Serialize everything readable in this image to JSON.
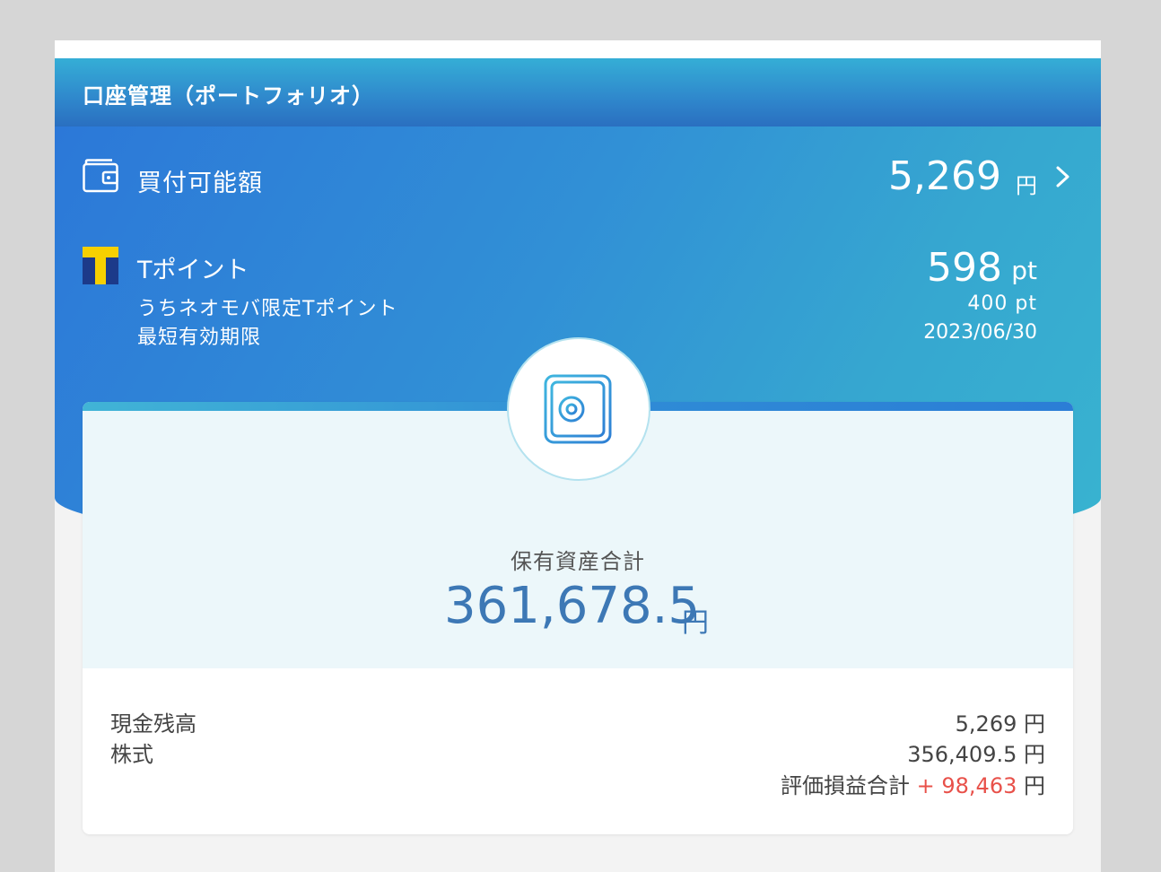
{
  "header": {
    "title": "口座管理（ポートフォリオ）"
  },
  "buying_power": {
    "label": "買付可能額",
    "value": "5,269",
    "unit": "円"
  },
  "tpoint": {
    "label": "Tポイント",
    "value": "598",
    "unit": "pt",
    "limited_label": "うちネオモバ限定Tポイント",
    "limited_value": "400 pt",
    "expiry_label": "最短有効期限",
    "expiry_date": "2023/06/30"
  },
  "assets": {
    "total_label": "保有資産合計",
    "total_value": "361,678.5",
    "total_unit": "円",
    "cash_label": "現金残高",
    "cash_value": "5,269 円",
    "stock_label": "株式",
    "stock_value": "356,409.5 円",
    "pl_label": "評価損益合計",
    "pl_sign": "+",
    "pl_value": "98,463",
    "pl_unit": "円"
  },
  "icons": {
    "wallet": "wallet-icon",
    "tpoint": "tpoint-logo-icon",
    "safe": "safe-icon",
    "chevron": "chevron-right-icon"
  },
  "colors": {
    "header_start": "#35aed6",
    "header_end": "#2a6fc0",
    "total_value": "#3d78b5",
    "profit": "#e8514a",
    "tpoint_yellow": "#f7d000",
    "tpoint_blue": "#1c3a8a"
  }
}
